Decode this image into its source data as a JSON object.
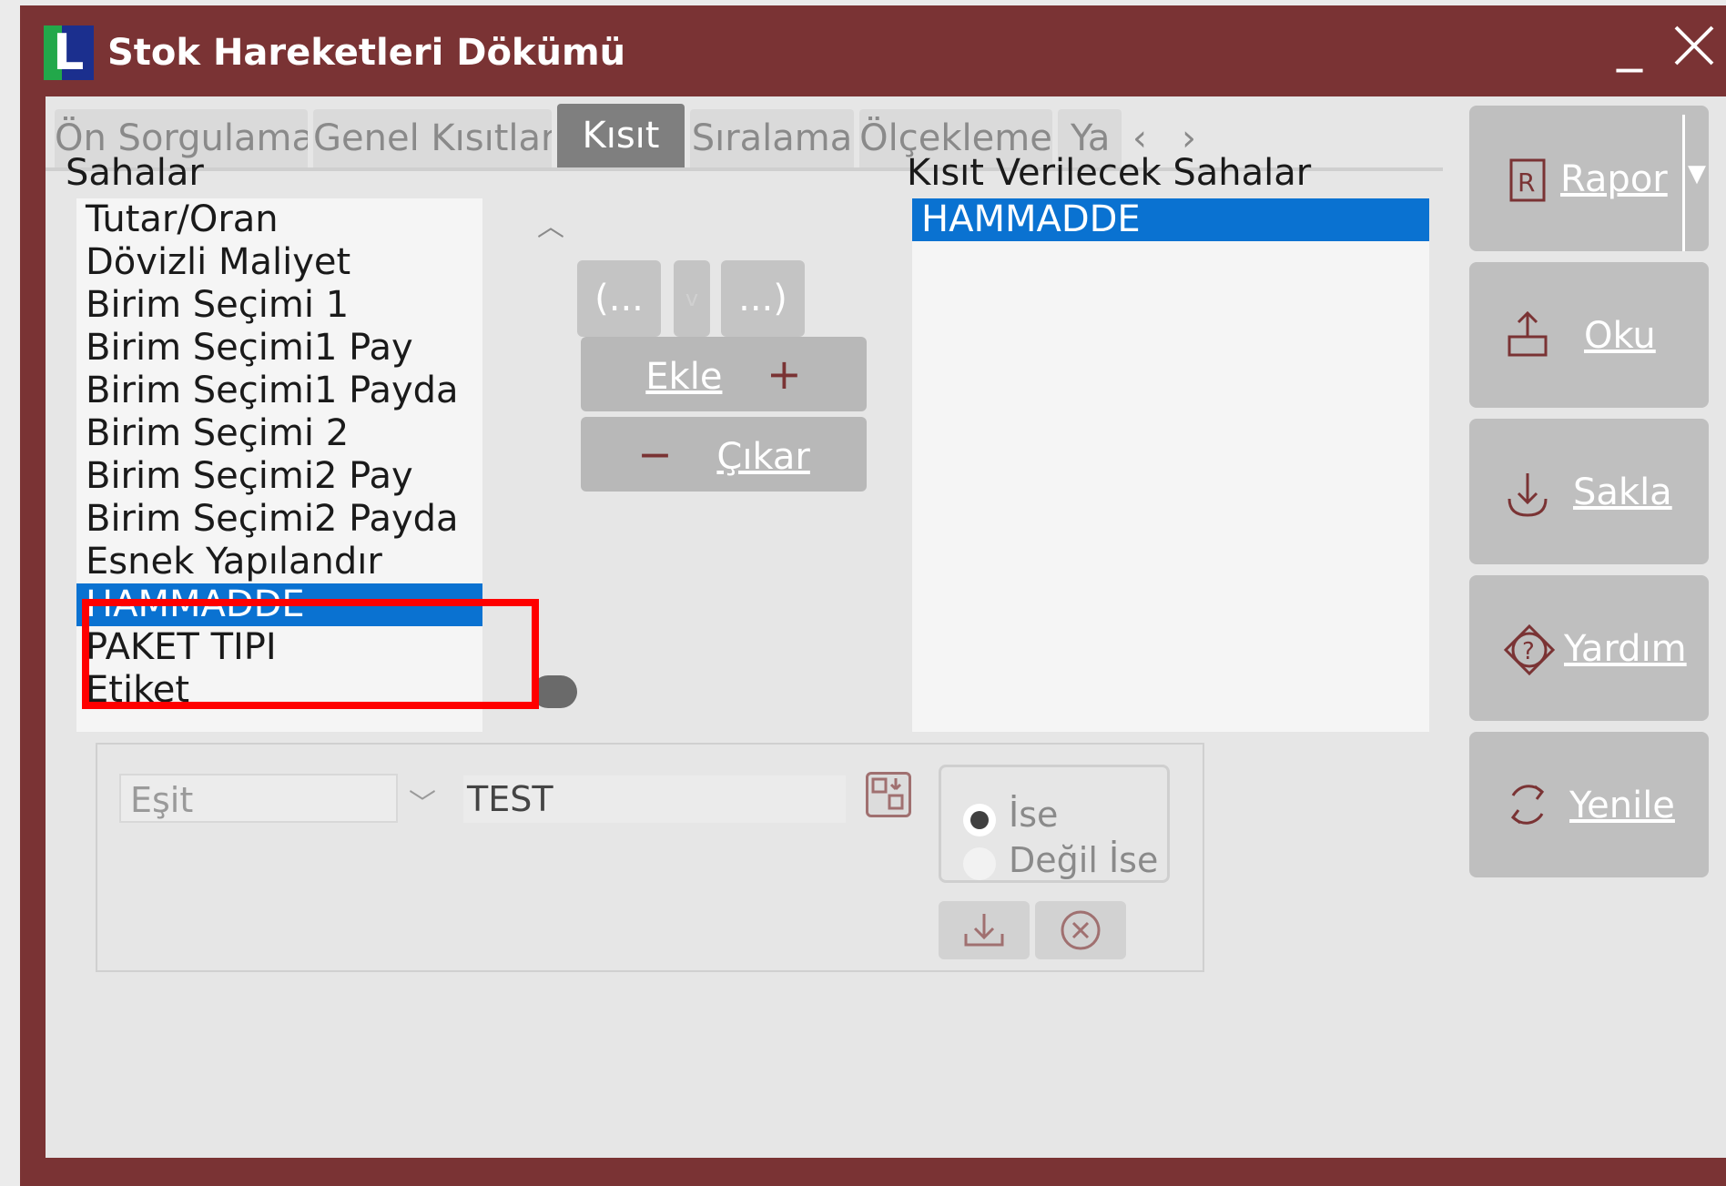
{
  "window": {
    "title": "Stok Hareketleri Dökümü",
    "icon_letter": "L",
    "minimize_glyph": "_",
    "close_glyph": "✕"
  },
  "tabs": [
    {
      "label": "Ön Sorgulama",
      "active": false
    },
    {
      "label": "Genel Kısıtlar",
      "active": false
    },
    {
      "label": "Kısıt",
      "active": true
    },
    {
      "label": "Sıralama",
      "active": false
    },
    {
      "label": "Ölçekleme",
      "active": false
    },
    {
      "label": "Ya",
      "active": false
    }
  ],
  "tab_nav": {
    "prev": "‹",
    "next": "›"
  },
  "fields_panel": {
    "label": "Sahalar",
    "items": [
      "Tutar/Oran",
      "Dövizli Maliyet",
      "Birim Seçimi 1",
      "Birim Seçimi1 Pay",
      "Birim Seçimi1 Payda",
      "Birim Seçimi 2",
      "Birim Seçimi2 Pay",
      "Birim Seçimi2 Payda",
      "Esnek Yapılandır",
      "HAMMADDE",
      "PAKET TIPI",
      "Etiket"
    ],
    "selected": "HAMMADDE"
  },
  "constraint_panel": {
    "label": "Kısıt Verilecek Sahalar",
    "items": [
      "HAMMADDE"
    ]
  },
  "paren_buttons": {
    "open": "(...",
    "mid": "v",
    "close": "...)"
  },
  "add_button": {
    "label": "Ekle",
    "glyph": "+"
  },
  "remove_button": {
    "label": "Çıkar",
    "glyph": "−"
  },
  "condition": {
    "operator": "Eşit",
    "value": "TEST",
    "radio_options": [
      {
        "label": "İse",
        "checked": true
      },
      {
        "label": "Değil İse",
        "checked": false
      }
    ]
  },
  "side_buttons": [
    {
      "label": "Rapor",
      "icon": "report-icon"
    },
    {
      "label": "Oku",
      "icon": "upload-icon"
    },
    {
      "label": "Sakla",
      "icon": "download-icon"
    },
    {
      "label": "Yardım",
      "icon": "help-icon"
    },
    {
      "label": "Yenile",
      "icon": "refresh-icon"
    }
  ],
  "colors": {
    "frame": "#7a3334",
    "selection": "#0a72d1",
    "highlight": "#ff0000"
  }
}
